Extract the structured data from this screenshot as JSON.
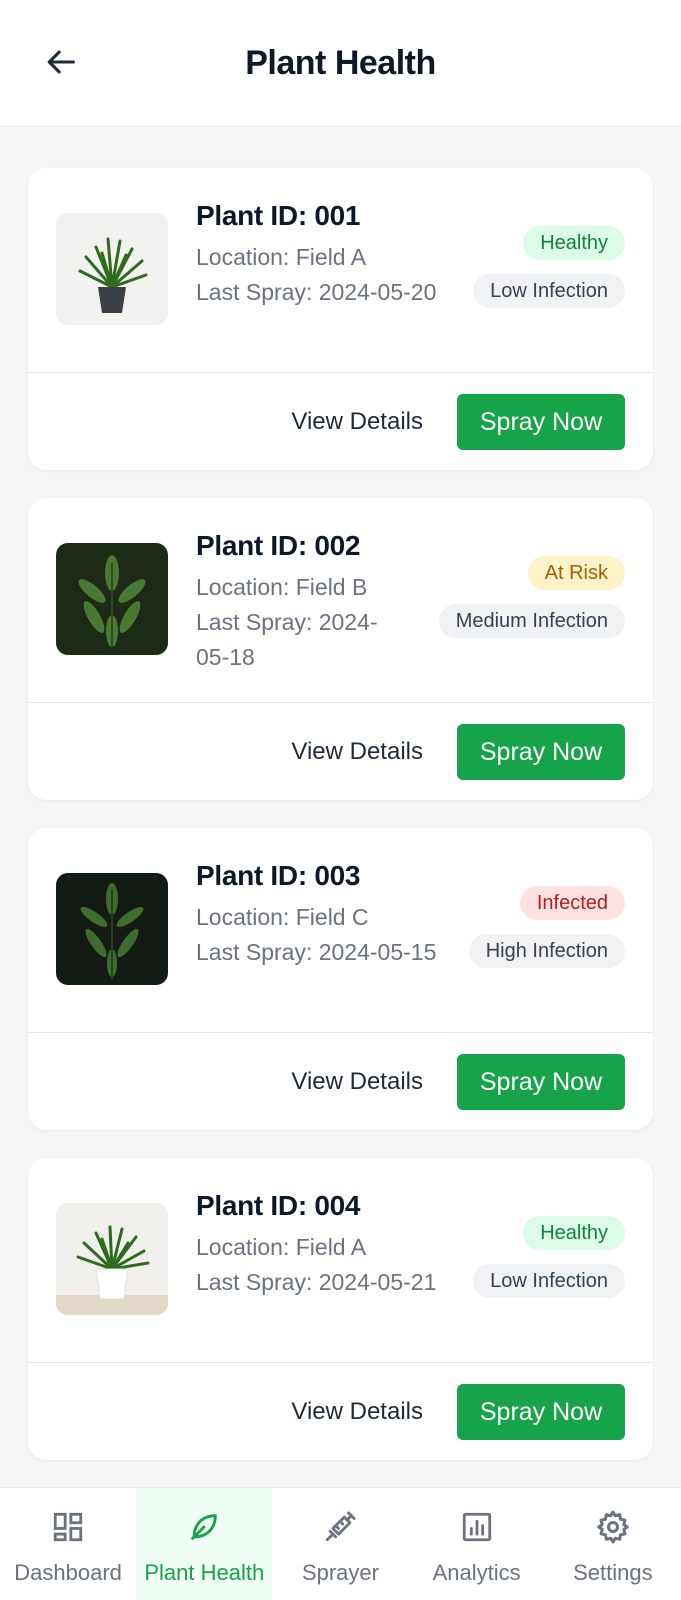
{
  "header": {
    "title": "Plant Health",
    "back_icon": "arrow-left-icon"
  },
  "plants": [
    {
      "id_label": "Plant ID: 001",
      "location": "Location: Field A",
      "last_spray": "Last Spray: 2024-05-20",
      "status": "Healthy",
      "status_color": "green",
      "infection": "Low Infection",
      "view_label": "View Details",
      "spray_label": "Spray Now"
    },
    {
      "id_label": "Plant ID: 002",
      "location": "Location: Field B",
      "last_spray": "Last Spray: 2024-05-18",
      "status": "At Risk",
      "status_color": "yellow",
      "infection": "Medium Infection",
      "view_label": "View Details",
      "spray_label": "Spray Now"
    },
    {
      "id_label": "Plant ID: 003",
      "location": "Location: Field C",
      "last_spray": "Last Spray: 2024-05-15",
      "status": "Infected",
      "status_color": "red",
      "infection": "High Infection",
      "view_label": "View Details",
      "spray_label": "Spray Now"
    },
    {
      "id_label": "Plant ID: 004",
      "location": "Location: Field A",
      "last_spray": "Last Spray: 2024-05-21",
      "status": "Healthy",
      "status_color": "green",
      "infection": "Low Infection",
      "view_label": "View Details",
      "spray_label": "Spray Now"
    }
  ],
  "nav": [
    {
      "label": "Dashboard",
      "icon": "dashboard-grid-icon",
      "active": false
    },
    {
      "label": "Plant Health",
      "icon": "leaf-icon",
      "active": true
    },
    {
      "label": "Sprayer",
      "icon": "sprayer-syringe-icon",
      "active": false
    },
    {
      "label": "Analytics",
      "icon": "bar-chart-icon",
      "active": false
    },
    {
      "label": "Settings",
      "icon": "gear-icon",
      "active": false
    }
  ],
  "colors": {
    "accent": "#16a34a",
    "background": "#f5f6f8",
    "title": "#0f172a"
  }
}
